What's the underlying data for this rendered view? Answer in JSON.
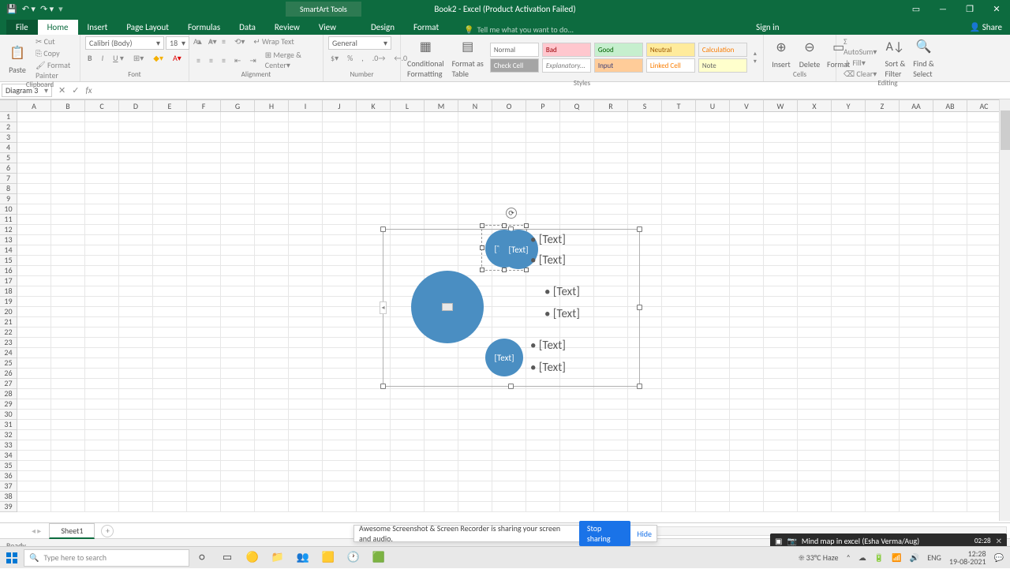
{
  "titlebar": {
    "title": "Book2 - Excel (Product Activation Failed)",
    "smartart_tools": "SmartArt Tools"
  },
  "windowbtns": {
    "min": "—",
    "max": "❐",
    "close": "✕",
    "ribmin": "▭"
  },
  "tabs": {
    "file": "File",
    "home": "Home",
    "insert": "Insert",
    "pagelayout": "Page Layout",
    "formulas": "Formulas",
    "data": "Data",
    "review": "Review",
    "view": "View",
    "design": "Design",
    "format": "Format"
  },
  "tellme": {
    "placeholder": "Tell me what you want to do..."
  },
  "account": {
    "signin": "Sign in",
    "share": "Share"
  },
  "ribbon": {
    "clipboard": {
      "paste": "Paste",
      "cut": "Cut",
      "copy": "Copy",
      "painter": "Format Painter",
      "label": "Clipboard"
    },
    "font": {
      "name": "Calibri (Body)",
      "size": "18",
      "label": "Font"
    },
    "alignment": {
      "wrap": "Wrap Text",
      "merge": "Merge & Center",
      "label": "Alignment"
    },
    "number": {
      "format": "General",
      "label": "Number"
    },
    "styles": {
      "cond": "Conditional\nFormatting",
      "tbl": "Format as\nTable",
      "normal": "Normal",
      "bad": "Bad",
      "good": "Good",
      "neutral": "Neutral",
      "calculation": "Calculation",
      "checkcell": "Check Cell",
      "explanatory": "Explanatory...",
      "input": "Input",
      "linked": "Linked Cell",
      "note": "Note",
      "label": "Styles"
    },
    "cells": {
      "insert": "Insert",
      "delete": "Delete",
      "format": "Format",
      "label": "Cells"
    },
    "editing": {
      "autosum": "AutoSum",
      "fill": "Fill",
      "clear": "Clear",
      "sort": "Sort &\nFilter",
      "find": "Find &\nSelect",
      "label": "Editing"
    }
  },
  "namebox": "Diagram 3",
  "columns": [
    "A",
    "B",
    "C",
    "D",
    "E",
    "F",
    "G",
    "H",
    "I",
    "J",
    "K",
    "L",
    "M",
    "N",
    "O",
    "P",
    "Q",
    "R",
    "S",
    "T",
    "U",
    "V",
    "W",
    "X",
    "Y",
    "Z",
    "AA",
    "AB",
    "AC"
  ],
  "rows": 39,
  "smartart": {
    "placeholder": "[Text]",
    "bullet": "• [Text]"
  },
  "sheet": {
    "tab": "Sheet1"
  },
  "status": {
    "ready": "Ready"
  },
  "sharebar": {
    "msg": "Awesome Screenshot & Screen Recorder is sharing your screen and audio.",
    "stop": "Stop sharing",
    "hide": "Hide"
  },
  "teams": {
    "title": "Mind map in excel (Esha Verma/Aug)",
    "time": "02:28"
  },
  "taskbar": {
    "search": "Type here to search",
    "weather": "33°C Haze",
    "lang": "ENG",
    "date": "19-08-2021",
    "time": "12:28"
  }
}
